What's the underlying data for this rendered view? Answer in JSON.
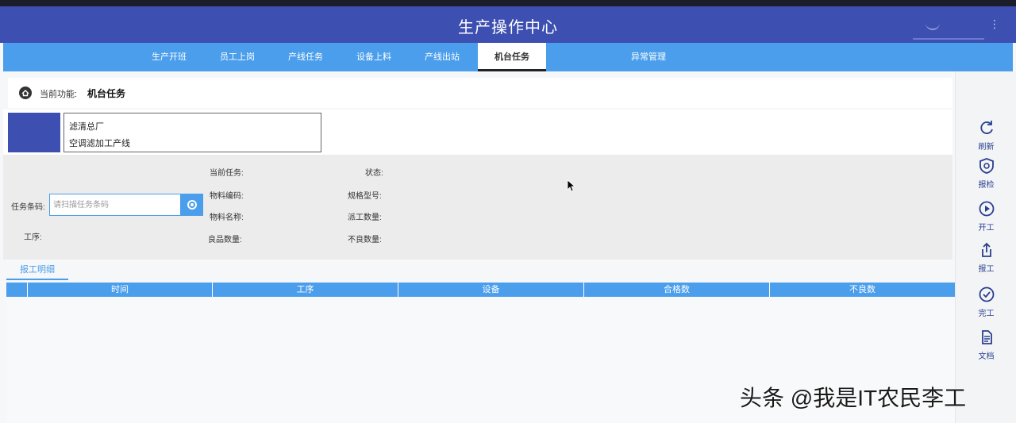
{
  "app": {
    "title": "生产操作中心"
  },
  "nav": {
    "tabs": [
      {
        "label": "生产开班"
      },
      {
        "label": "员工上岗"
      },
      {
        "label": "产线任务"
      },
      {
        "label": "设备上料"
      },
      {
        "label": "产线出站"
      },
      {
        "label": "机台任务",
        "active": true
      },
      {
        "label": ""
      },
      {
        "label": "异常管理"
      }
    ]
  },
  "breadcrumb": {
    "label": "当前功能:",
    "value": "机台任务"
  },
  "info": {
    "line1": "滤清总厂",
    "line2": "空调滤加工产线"
  },
  "form": {
    "task_barcode_label": "任务条码:",
    "task_barcode_placeholder": "请扫描任务条码",
    "process_label": "工序:",
    "current_task_label": "当前任务:",
    "material_code_label": "物料编码:",
    "material_name_label": "物料名称:",
    "good_qty_label": "良品数量:",
    "status_label": "状态:",
    "spec_model_label": "规格型号:",
    "dispatch_qty_label": "派工数量:",
    "defect_qty_label": "不良数量:"
  },
  "subtabs": {
    "report_detail": "报工明细"
  },
  "table": {
    "columns": [
      "",
      "时间",
      "工序",
      "设备",
      "合格数",
      "不良数"
    ]
  },
  "sidebar": {
    "buttons": [
      {
        "label": "刷新",
        "icon": "refresh-icon"
      },
      {
        "label": "报检",
        "icon": "inspect-icon"
      },
      {
        "label": "开工",
        "icon": "play-icon"
      },
      {
        "label": "报工",
        "icon": "upload-icon"
      },
      {
        "label": "完工",
        "icon": "check-icon"
      },
      {
        "label": "文档",
        "icon": "document-icon"
      }
    ]
  },
  "watermark": "头条 @我是IT农民李工",
  "colors": {
    "header": "#3d4fb0",
    "nav": "#4a9eeb",
    "accent": "#2a3f8f"
  }
}
